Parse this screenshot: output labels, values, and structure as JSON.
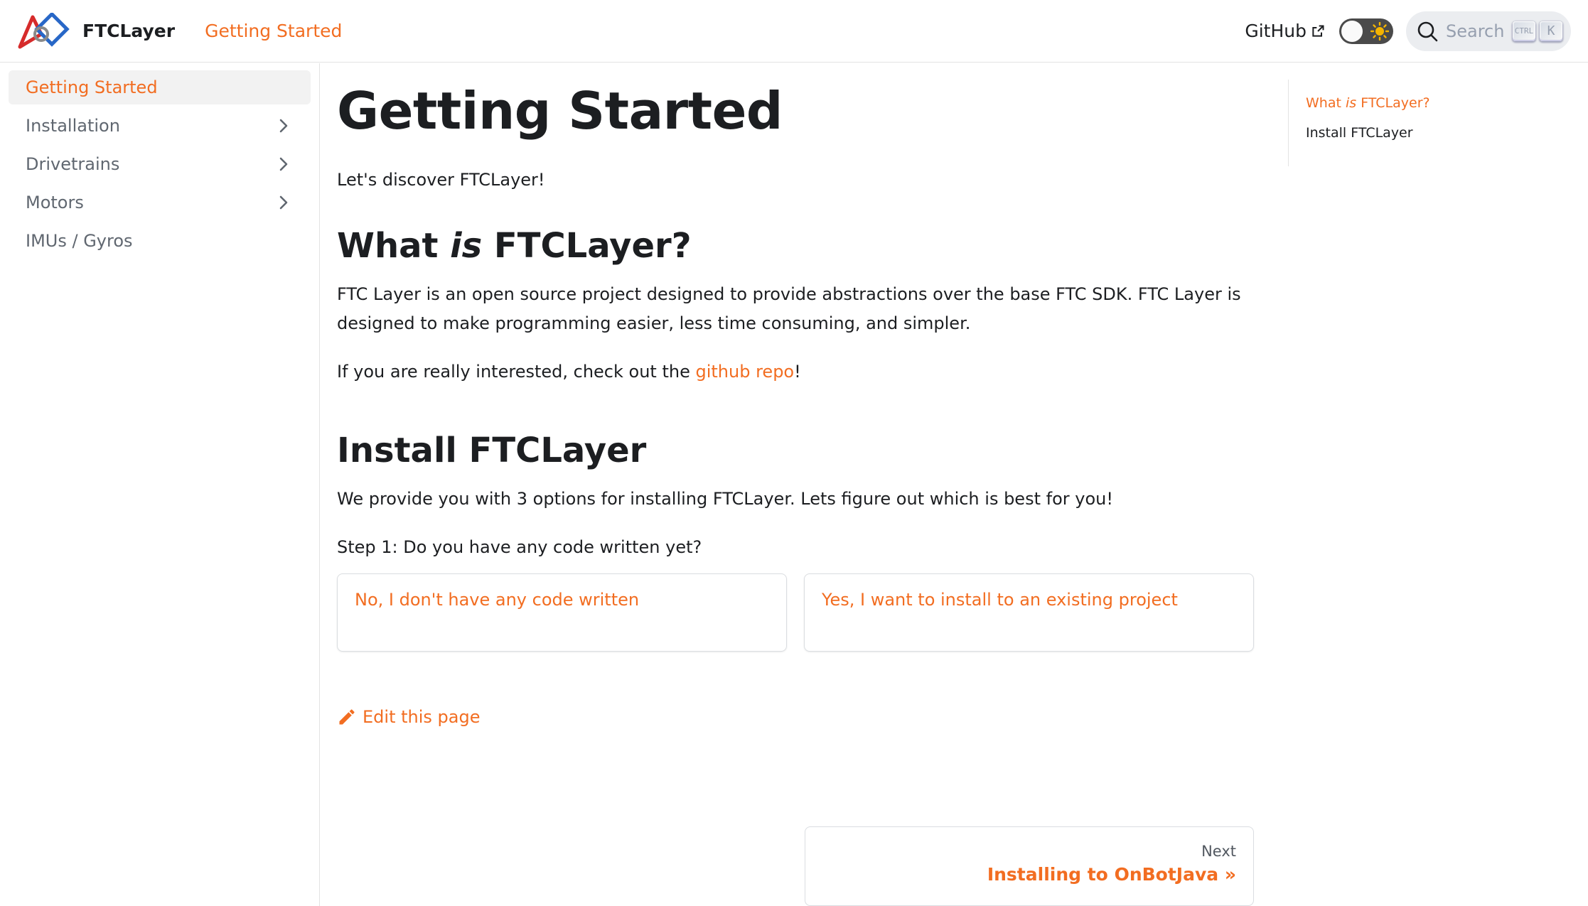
{
  "navbar": {
    "brand": "FTCLayer",
    "active_link": "Getting Started",
    "github_label": "GitHub",
    "search_placeholder": "Search",
    "kbd_ctrl": "CTRL",
    "kbd_k": "K"
  },
  "sidebar": {
    "items": [
      {
        "label": "Getting Started",
        "active": true,
        "expandable": false
      },
      {
        "label": "Installation",
        "active": false,
        "expandable": true
      },
      {
        "label": "Drivetrains",
        "active": false,
        "expandable": true
      },
      {
        "label": "Motors",
        "active": false,
        "expandable": true
      },
      {
        "label": "IMUs / Gyros",
        "active": false,
        "expandable": false
      }
    ]
  },
  "main": {
    "title": "Getting Started",
    "intro": "Let's discover FTCLayer!",
    "section1": {
      "heading_pre": "What ",
      "heading_em": "is",
      "heading_post": " FTCLayer?",
      "para": "FTC Layer is an open source project designed to provide abstractions over the base FTC SDK. FTC Layer is designed to make programming easier, less time consuming, and simpler.",
      "interest_pre": "If you are really interested, check out the ",
      "interest_link": "github repo",
      "interest_post": "!"
    },
    "section2": {
      "heading": "Install FTCLayer",
      "para": "We provide you with 3 options for installing FTCLayer. Lets figure out which is best for you!",
      "step": "Step 1: Do you have any code written yet?",
      "card_no": "No, I don't have any code written",
      "card_yes": "Yes, I want to install to an existing project"
    },
    "edit_label": "Edit this page",
    "pager": {
      "sub": "Next",
      "label": "Installing to OnBotJava »"
    }
  },
  "toc": {
    "item1_pre": "What ",
    "item1_em": "is",
    "item1_post": " FTCLayer?",
    "item2": "Install FTCLayer"
  },
  "colors": {
    "accent": "#f26d21",
    "text": "#1c1e21",
    "muted": "#606770",
    "border": "#e3e3e3"
  }
}
